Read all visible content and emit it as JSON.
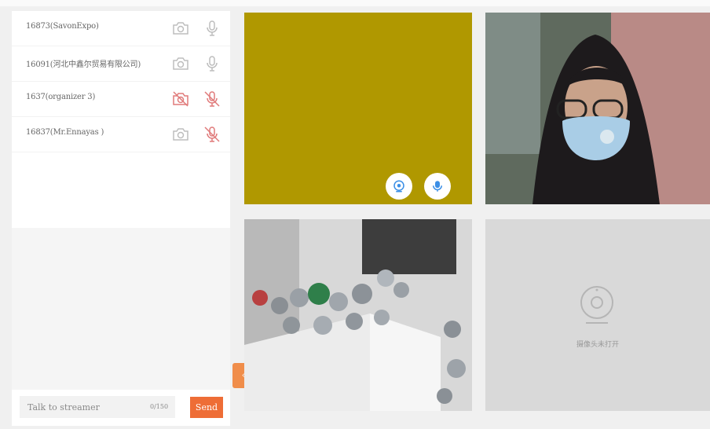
{
  "participants": [
    {
      "name": "16873(SavonExpo)",
      "camera_on": true,
      "mic_on": true
    },
    {
      "name": "16091(河北中鑫尔贸易有限公司)",
      "camera_on": true,
      "mic_on": true
    },
    {
      "name": "1637(organizer 3)",
      "camera_on": false,
      "mic_on": false
    },
    {
      "name": "16837(Mr.Ennayas )",
      "camera_on": true,
      "mic_on": false
    }
  ],
  "chat": {
    "placeholder": "Talk to streamer",
    "char_count": "0/150",
    "send_label": "Send"
  },
  "collapse_toggle_label": "‹",
  "camera_off_text": "摄像头未打开",
  "colors": {
    "accent": "#ee6d36",
    "icon_gray": "#bdbdbd",
    "icon_disabled": "#e07a7a",
    "control_blue": "#3b8fe6"
  }
}
